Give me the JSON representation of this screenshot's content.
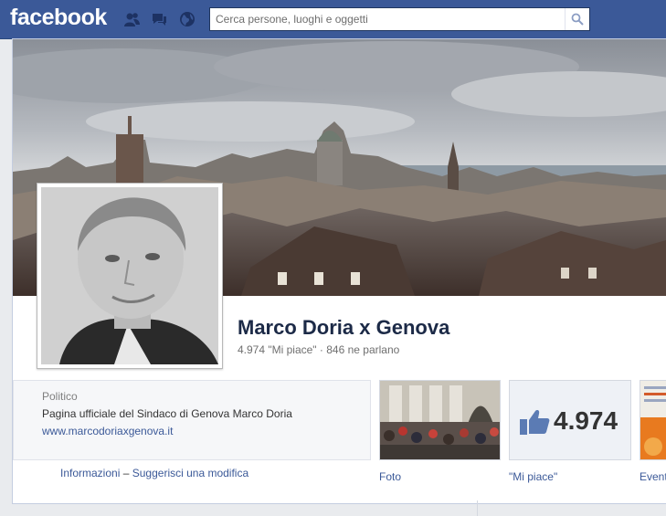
{
  "header": {
    "logo": "facebook",
    "search_placeholder": "Cerca persone, luoghi e oggetti",
    "icons": [
      "friends-icon",
      "messages-icon",
      "globe-icon",
      "search-icon"
    ]
  },
  "page": {
    "name": "Marco Doria x Genova",
    "stats": "4.974 \"Mi piace\" · 846 ne parlano"
  },
  "about": {
    "category": "Politico",
    "description": "Pagina ufficiale del Sindaco di Genova Marco Doria",
    "website": "www.marcodoriaxgenova.it",
    "info_link": "Informazioni",
    "separator": "–",
    "suggest_link": "Suggerisci una modifica"
  },
  "tiles": {
    "photos_label": "Foto",
    "likes_count": "4.974",
    "likes_label": "\"Mi piace\"",
    "events_label": "Eventi"
  },
  "colors": {
    "brand": "#3b5998",
    "page_bg": "#e9ebee",
    "link": "#3b5998"
  }
}
